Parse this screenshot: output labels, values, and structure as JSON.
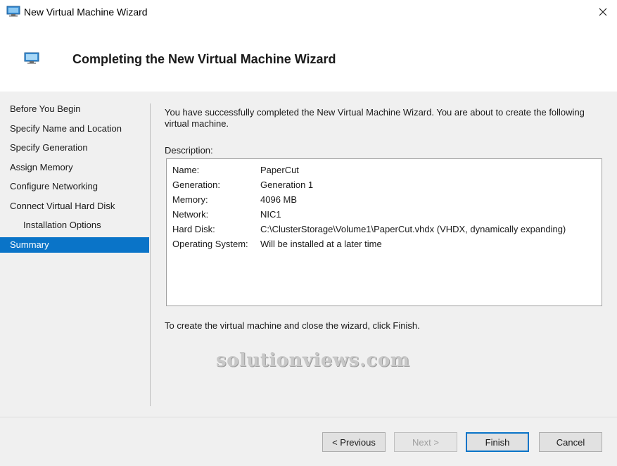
{
  "window": {
    "title": "New Virtual Machine Wizard",
    "close_glyph": "✕",
    "icon": "virtual-machine-icon"
  },
  "header": {
    "title": "Completing the New Virtual Machine Wizard",
    "icon": "virtual-machine-icon"
  },
  "nav": {
    "items": [
      {
        "label": "Before You Begin"
      },
      {
        "label": "Specify Name and Location"
      },
      {
        "label": "Specify Generation"
      },
      {
        "label": "Assign Memory"
      },
      {
        "label": "Configure Networking"
      },
      {
        "label": "Connect Virtual Hard Disk"
      },
      {
        "label": "Installation Options"
      },
      {
        "label": "Summary"
      }
    ],
    "active_color": "#0a74c8"
  },
  "content": {
    "intro": "You have successfully completed the New Virtual Machine Wizard. You are about to create the following virtual machine.",
    "description_label": "Description:",
    "rows": [
      {
        "key": "Name:",
        "value": "PaperCut"
      },
      {
        "key": "Generation:",
        "value": "Generation 1"
      },
      {
        "key": "Memory:",
        "value": "4096 MB"
      },
      {
        "key": "Network:",
        "value": "NIC1"
      },
      {
        "key": "Hard Disk:",
        "value": "C:\\ClusterStorage\\Volume1\\PaperCut.vhdx (VHDX, dynamically expanding)"
      },
      {
        "key": "Operating System:",
        "value": "Will be installed at a later time"
      }
    ],
    "finish_note": "To create the virtual machine and close the wizard, click Finish."
  },
  "watermark": "solutionviews.com",
  "buttons": {
    "previous": "< Previous",
    "next": "Next >",
    "finish": "Finish",
    "cancel": "Cancel"
  }
}
